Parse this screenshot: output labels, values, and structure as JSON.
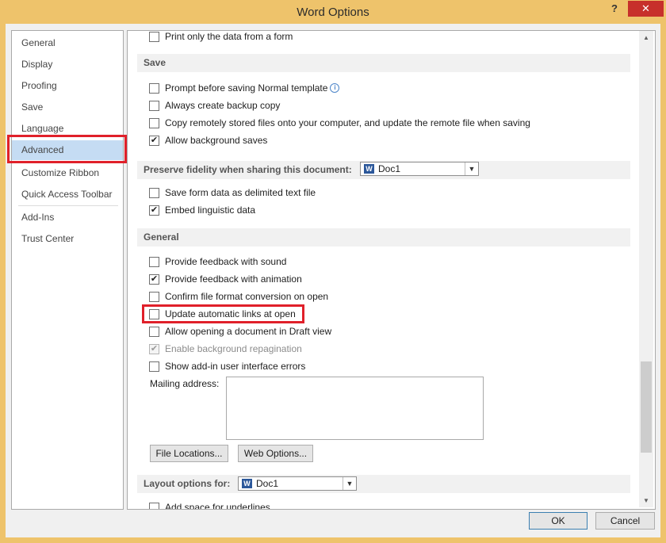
{
  "window": {
    "title": "Word Options",
    "help_label": "?",
    "close_label": "✕"
  },
  "nav": {
    "items": [
      {
        "label": "General"
      },
      {
        "label": "Display"
      },
      {
        "label": "Proofing"
      },
      {
        "label": "Save"
      },
      {
        "label": "Language"
      },
      {
        "label": "Advanced",
        "selected": true
      },
      {
        "label": "Customize Ribbon"
      },
      {
        "label": "Quick Access Toolbar"
      },
      {
        "label": "Add-Ins"
      },
      {
        "label": "Trust Center"
      }
    ]
  },
  "content": {
    "top_option": {
      "label": "Print only the data from a form",
      "checked": false
    },
    "save": {
      "heading": "Save",
      "options": [
        {
          "label": "Prompt before saving Normal template",
          "checked": false,
          "info_icon": "info-icon"
        },
        {
          "label": "Always create backup copy",
          "checked": false
        },
        {
          "label": "Copy remotely stored files onto your computer, and update the remote file when saving",
          "checked": false
        },
        {
          "label": "Allow background saves",
          "checked": true
        }
      ]
    },
    "fidelity": {
      "heading": "Preserve fidelity when sharing this document:",
      "document": "Doc1",
      "options": [
        {
          "label": "Save form data as delimited text file",
          "checked": false
        },
        {
          "label": "Embed linguistic data",
          "checked": true
        }
      ]
    },
    "general": {
      "heading": "General",
      "options": [
        {
          "label": "Provide feedback with sound",
          "checked": false
        },
        {
          "label": "Provide feedback with animation",
          "checked": true
        },
        {
          "label": "Confirm file format conversion on open",
          "checked": false
        },
        {
          "label": "Update automatic links at open",
          "checked": false
        },
        {
          "label": "Allow opening a document in Draft view",
          "checked": false
        },
        {
          "label": "Enable background repagination",
          "checked": true,
          "disabled": true
        },
        {
          "label": "Show add-in user interface errors",
          "checked": false
        }
      ],
      "mailing_address_label": "Mailing address:",
      "mailing_address_value": "",
      "file_locations_button": "File Locations...",
      "web_options_button": "Web Options..."
    },
    "layout": {
      "heading": "Layout options for:",
      "document": "Doc1",
      "partial_option": "Add space for underlines"
    }
  },
  "footer": {
    "ok_label": "OK",
    "cancel_label": "Cancel"
  },
  "colors": {
    "title_bar": "#eec36b",
    "close_button": "#c7302b",
    "nav_selected": "#c5dcf3",
    "highlight_outline": "#e0202a"
  }
}
